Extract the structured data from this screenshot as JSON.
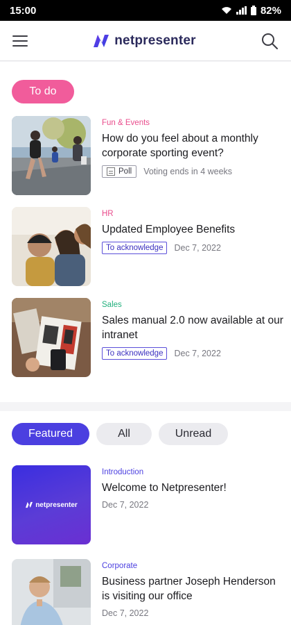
{
  "status": {
    "time": "15:00",
    "battery": "82%"
  },
  "header": {
    "brand": "netpresenter"
  },
  "todo": {
    "label": "To do",
    "items": [
      {
        "category": "Fun & Events",
        "category_color": "#e94c8c",
        "title": "How do you feel about a monthly corporate sporting event?",
        "tag": "Poll",
        "meta": "Voting ends in 4 weeks"
      },
      {
        "category": "HR",
        "category_color": "#e94c8c",
        "title": "Updated Employee Benefits",
        "tag": "To acknowledge",
        "meta": "Dec 7, 2022"
      },
      {
        "category": "Sales",
        "category_color": "#22b07d",
        "title": "Sales manual 2.0 now available at our intranet",
        "tag": "To acknowledge",
        "meta": "Dec 7, 2022"
      }
    ]
  },
  "filters": {
    "featured": "Featured",
    "all": "All",
    "unread": "Unread"
  },
  "featured": {
    "items": [
      {
        "category": "Introduction",
        "category_color": "#4b3fe0",
        "title": "Welcome to Netpresenter!",
        "meta": "Dec 7, 2022"
      },
      {
        "category": "Corporate",
        "category_color": "#4b3fe0",
        "title": "Business partner Joseph Henderson is visiting our office",
        "meta": "Dec 7, 2022"
      }
    ]
  },
  "colors": {
    "accent": "#4b3fe0",
    "pink": "#f15c9b",
    "sales": "#22b07d"
  }
}
